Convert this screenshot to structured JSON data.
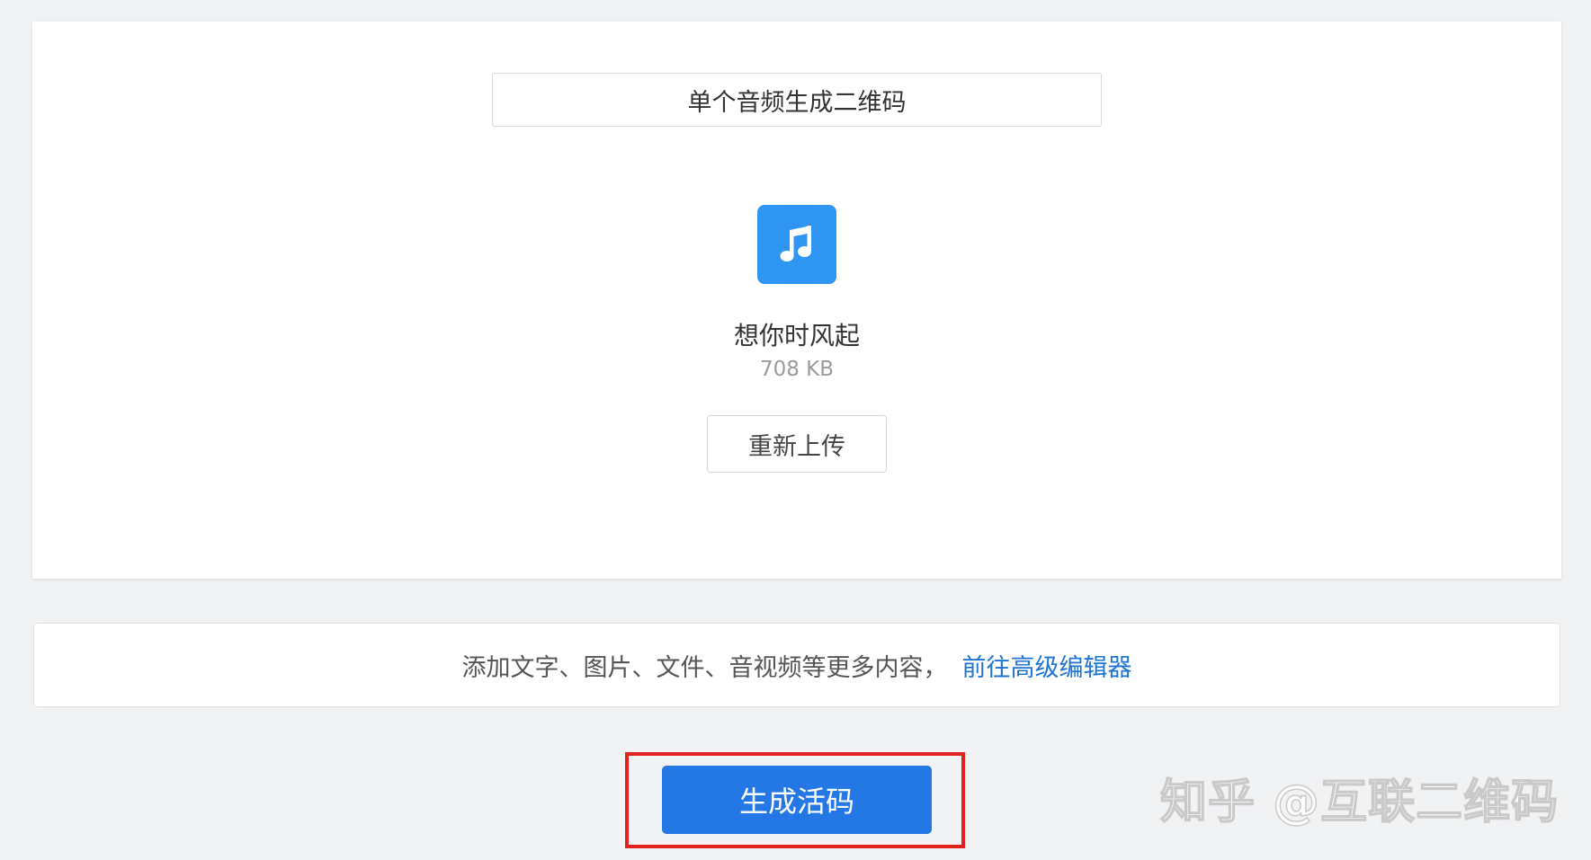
{
  "mode": {
    "label": "单个音频生成二维码"
  },
  "file": {
    "icon": "music-note-icon",
    "icon_color": "#2f95f3",
    "name": "想你时风起",
    "size": "708 KB"
  },
  "reupload": {
    "label": "重新上传"
  },
  "hint": {
    "text": "添加文字、图片、文件、音视频等更多内容，",
    "link_label": "前往高级编辑器",
    "link_color": "#1e74d3"
  },
  "generate": {
    "label": "生成活码",
    "color": "#2378e6",
    "highlight_color": "#e0231c"
  },
  "watermark": {
    "text": "知乎 @互联二维码"
  }
}
